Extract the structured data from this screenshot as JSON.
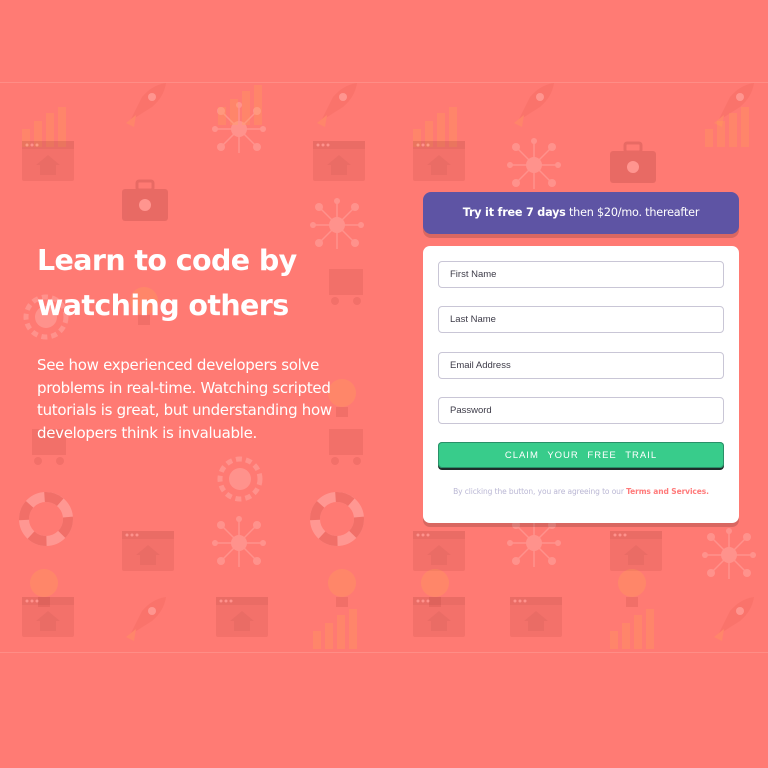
{
  "hero": {
    "title": "Learn to code by watching others",
    "description": "See how experienced developers solve problems in real-time. Watching scripted tutorials is great, but understanding how developers think is invaluable."
  },
  "offer": {
    "bold": "Try it free 7 days",
    "rest": " then $20/mo. thereafter"
  },
  "form": {
    "first_name_placeholder": "First Name",
    "last_name_placeholder": "Last Name",
    "email_placeholder": "Email Address",
    "password_placeholder": "Password",
    "submit_label": "Claim your free trail",
    "terms_text": "By clicking the button, you are agreeing to our ",
    "terms_link": "Terms and Services."
  },
  "colors": {
    "background": "#ff7a73",
    "offer_banner": "#5e54a4",
    "cta": "#38cc8b",
    "terms_link": "#ff7a7a"
  },
  "icons": [
    "browser-home-icon",
    "rocket-icon",
    "bar-chart-icon",
    "toolbox-icon",
    "headset-icon",
    "network-icon",
    "lightbulb-icon",
    "key-icon",
    "lifebuoy-icon",
    "globe-gear-icon"
  ]
}
